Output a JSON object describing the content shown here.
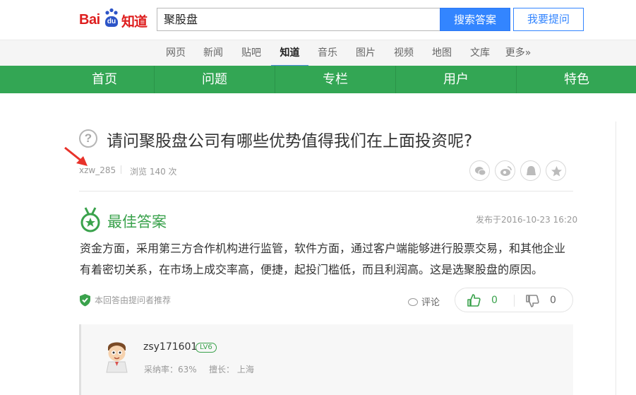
{
  "header": {
    "logo": {
      "bai": "Bai",
      "du": "du",
      "zhidao": "知道"
    },
    "search": {
      "value": "聚股盘"
    },
    "search_button": "搜索答案",
    "ask_button": "我要提问"
  },
  "channels": [
    "网页",
    "新闻",
    "贴吧",
    "知道",
    "音乐",
    "图片",
    "视频",
    "地图",
    "文库",
    "更多»"
  ],
  "active_channel": "知道",
  "green_nav": [
    "首页",
    "问题",
    "专栏",
    "用户",
    "特色"
  ],
  "question": {
    "icon": "question-mark-icon",
    "title": "请问聚股盘公司有哪些优势值得我们在上面投资呢?",
    "asker": "xzw_285",
    "views": "浏览 140 次",
    "share_icons": [
      "wechat-icon",
      "weibo-icon",
      "qzone-icon",
      "favorite-star-icon"
    ]
  },
  "best_answer": {
    "label": "最佳答案",
    "time": "发布于2016-10-23 16:20",
    "text_line1": "资金方面，采用第三方合作机构进行监管，软件方面，通过客户端能够进行股票交易，和其他企业",
    "text_line2": "有着密切关系，在市场上成交率高，便捷，起投门槛低，而且利润高。这是选聚股盘的原因。",
    "recommend": "本回答由提问者推荐",
    "comment": "评论",
    "upvotes": "0",
    "downvotes": "0"
  },
  "answerer": {
    "name": "zsy171601",
    "level": "LV6",
    "adopt_rate": "采纳率：63%",
    "expertise": "擅长：  上海"
  },
  "colors": {
    "green": "#33a654",
    "blue": "#3385ff",
    "brand_red": "#de1e1e"
  }
}
